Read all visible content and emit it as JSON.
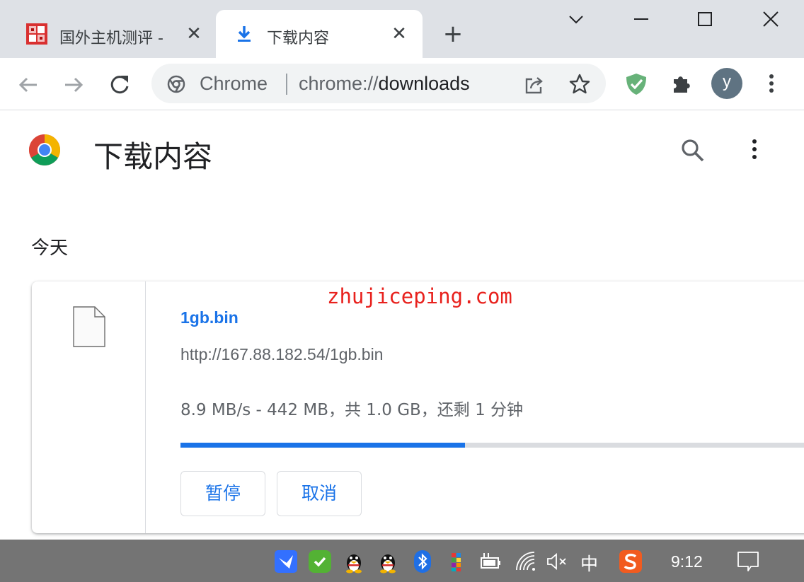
{
  "tabs": [
    {
      "title": "国外主机测评 -",
      "icon": "site-favicon",
      "close": "✕"
    },
    {
      "title": "下载内容",
      "icon": "download-icon",
      "close": "✕"
    }
  ],
  "new_tab": "+",
  "window_controls": [
    "chevron-down-icon",
    "minimize-icon",
    "maximize-icon",
    "close-icon"
  ],
  "omnibox": {
    "site_label": "Chrome",
    "url_prefix": "chrome://",
    "url_rest": "downloads"
  },
  "profile": {
    "initial": "y"
  },
  "page": {
    "title": "下载内容",
    "date_group": "今天"
  },
  "download": {
    "file_name": "1gb.bin",
    "url": "http://167.88.182.54/1gb.bin",
    "status": "8.9 MB/s - 442 MB，共 1.0 GB，还剩 1 分钟",
    "progress": 0.442,
    "pause_label": "暂停",
    "cancel_label": "取消"
  },
  "watermark": "zhujiceping.com",
  "taskbar": {
    "ime_label": "中",
    "clock": "9:12",
    "tray_icons": [
      "feishu-icon",
      "security-shield-icon",
      "qq-icon",
      "qq-icon",
      "bluetooth-icon",
      "color-grid-icon",
      "battery-icon",
      "wifi-icon",
      "mute-speaker-icon",
      "sogou-icon",
      "notification-icon"
    ]
  },
  "colors": {
    "accent": "#1a73e8",
    "tabstrip": "#dee1e6",
    "taskbar": "#747474",
    "watermark": "#e8211d"
  }
}
